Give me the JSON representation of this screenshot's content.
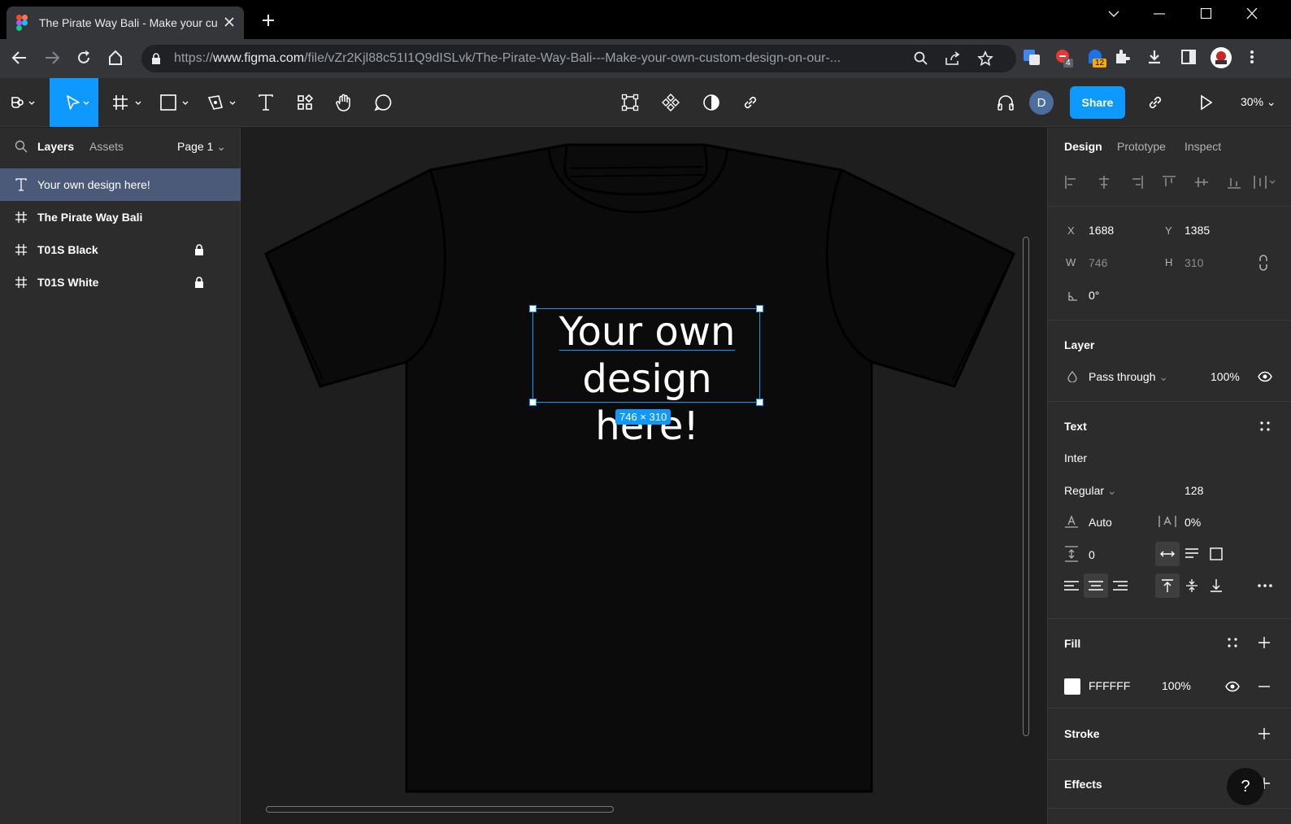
{
  "browser": {
    "tab_title": "The Pirate Way Bali - Make your custom design",
    "url_prefix": "https://",
    "url_domain": "www.figma.com",
    "url_path": "/file/vZr2Kjl88c51I1Q9dISLvk/The-Pirate-Way-Bali---Make-your-own-custom-design-on-our-...",
    "ext_badge_1": "4",
    "ext_badge_2": "12"
  },
  "toolbar": {
    "share_label": "Share",
    "avatar_initial": "D",
    "zoom": "30%"
  },
  "left_panel": {
    "tabs": [
      "Layers",
      "Assets"
    ],
    "page": "Page 1",
    "layers": [
      {
        "name": "Your own design here!",
        "type": "text",
        "locked": false,
        "selected": true
      },
      {
        "name": "The Pirate Way Bali",
        "type": "frame",
        "locked": false,
        "selected": false
      },
      {
        "name": "T01S Black",
        "type": "frame",
        "locked": true,
        "selected": false
      },
      {
        "name": "T01S White",
        "type": "frame",
        "locked": true,
        "selected": false
      }
    ]
  },
  "canvas": {
    "text_line1": "Your own",
    "text_line2": "design here!",
    "dimensions": "746 × 310"
  },
  "right_panel": {
    "tabs": [
      "Design",
      "Prototype",
      "Inspect"
    ],
    "x_label": "X",
    "x_value": "1688",
    "y_label": "Y",
    "y_value": "1385",
    "w_label": "W",
    "w_value": "746",
    "h_label": "H",
    "h_value": "310",
    "rotation": "0°",
    "layer_title": "Layer",
    "blend_mode": "Pass through",
    "layer_opacity": "100%",
    "text_title": "Text",
    "font_family": "Inter",
    "font_weight": "Regular",
    "font_size": "128",
    "line_height": "Auto",
    "letter_spacing": "0%",
    "paragraph_spacing": "0",
    "fill_title": "Fill",
    "fill_hex": "FFFFFF",
    "fill_opacity": "100%",
    "stroke_title": "Stroke",
    "effects_title": "Effects",
    "help": "?"
  },
  "colors": {
    "accent": "#0d99ff",
    "panel_bg": "#2c2c2c",
    "canvas_bg": "#1e1e1e",
    "selected_layer": "#4c5a7a"
  }
}
